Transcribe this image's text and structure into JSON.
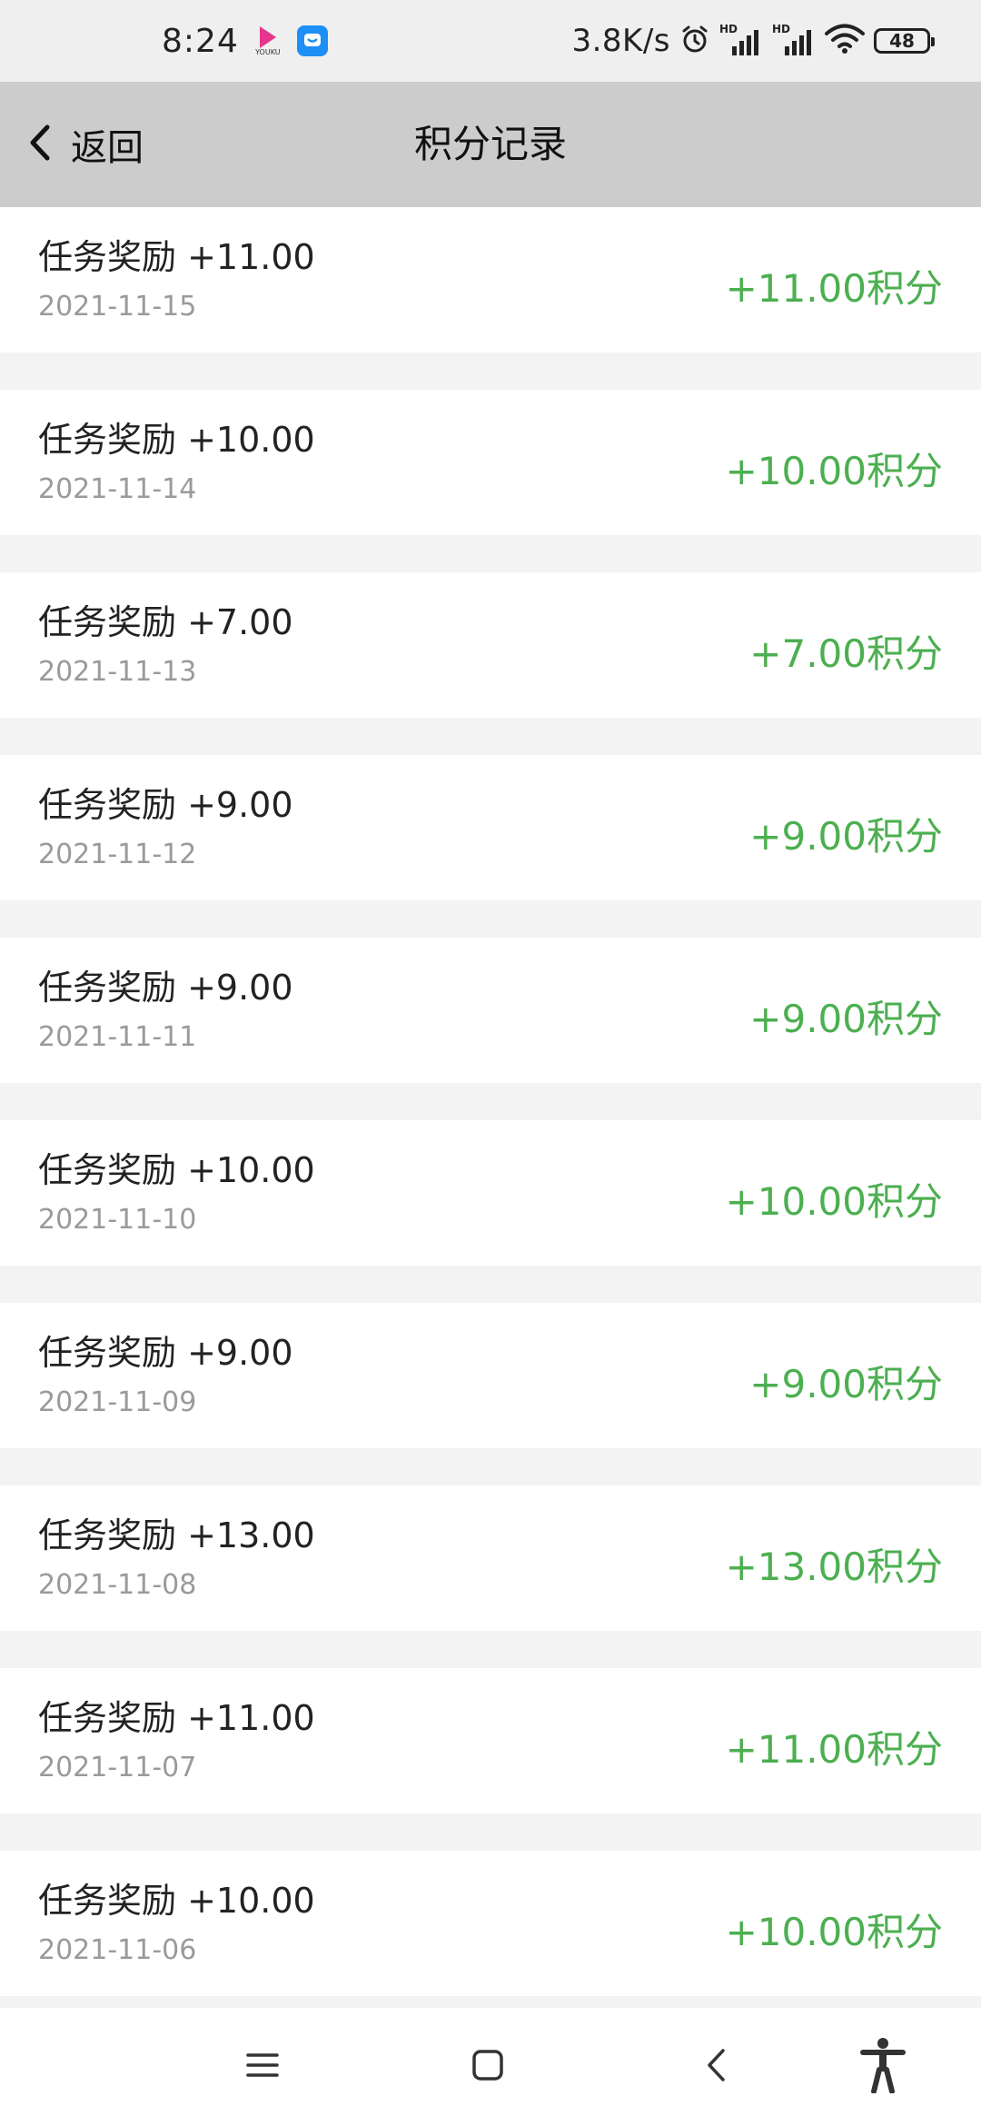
{
  "status_bar": {
    "time": "8:24",
    "youku_label": "YOUKU",
    "net_speed": "3.8K/s",
    "signal1_label": "HD",
    "signal2_label": "HD",
    "battery": "48"
  },
  "header": {
    "back_label": "返回",
    "title": "积分记录"
  },
  "records": [
    {
      "title": "任务奖励 +11.00",
      "date": "2021-11-15",
      "amount": "+11.00积分"
    },
    {
      "title": "任务奖励 +10.00",
      "date": "2021-11-14",
      "amount": "+10.00积分"
    },
    {
      "title": "任务奖励 +7.00",
      "date": "2021-11-13",
      "amount": "+7.00积分"
    },
    {
      "title": "任务奖励 +9.00",
      "date": "2021-11-12",
      "amount": "+9.00积分"
    },
    {
      "title": "任务奖励 +9.00",
      "date": "2021-11-11",
      "amount": "+9.00积分"
    },
    {
      "title": "任务奖励 +10.00",
      "date": "2021-11-10",
      "amount": "+10.00积分"
    },
    {
      "title": "任务奖励 +9.00",
      "date": "2021-11-09",
      "amount": "+9.00积分"
    },
    {
      "title": "任务奖励 +13.00",
      "date": "2021-11-08",
      "amount": "+13.00积分"
    },
    {
      "title": "任务奖励 +11.00",
      "date": "2021-11-07",
      "amount": "+11.00积分"
    },
    {
      "title": "任务奖励 +10.00",
      "date": "2021-11-06",
      "amount": "+10.00积分"
    }
  ],
  "colors": {
    "header_bg": "#cccccc",
    "amount_green": "#4caf50",
    "date_gray": "#9a9a9a"
  },
  "icons": {
    "back": "chevron-left-icon",
    "alarm": "alarm-icon",
    "wifi": "wifi-icon",
    "menu": "menu-icon",
    "home": "home-icon",
    "nav_back": "back-icon",
    "accessibility": "accessibility-icon"
  }
}
